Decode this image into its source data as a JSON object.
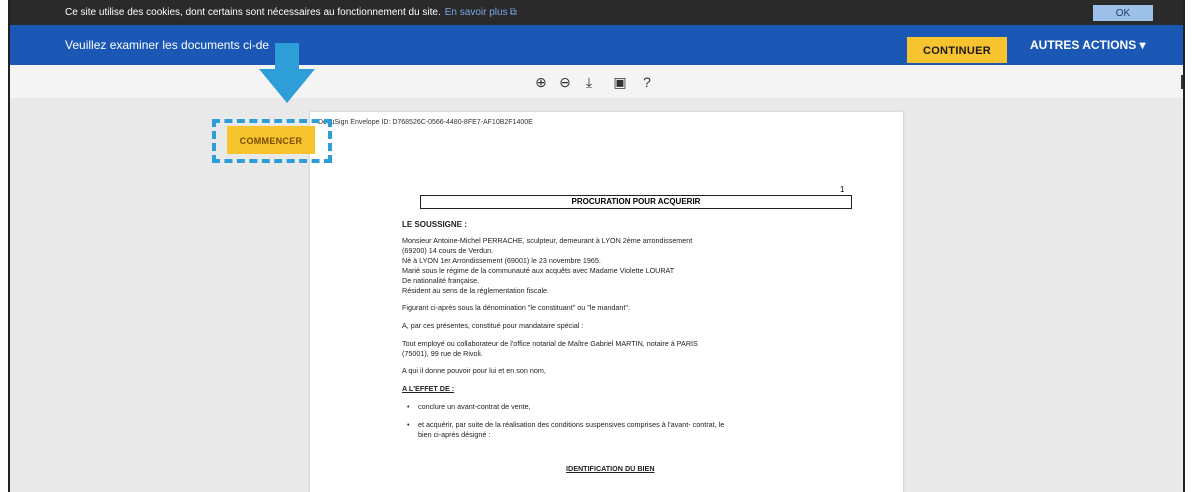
{
  "cookie": {
    "text": "Ce site utilise des cookies, dont certains sont nécessaires au fonctionnement du site.",
    "link": "En savoir plus",
    "ok": "OK"
  },
  "header": {
    "review_text": "Veuillez examiner les documents ci-de",
    "continue": "CONTINUER",
    "other_actions": "AUTRES ACTIONS ▾"
  },
  "toolbar": {
    "icons": [
      "zoom-in-icon",
      "zoom-out-icon",
      "download-icon",
      "print-icon",
      "help-icon"
    ]
  },
  "start_button": "COMMENCER",
  "document": {
    "envelope": "DocuSign Envelope ID: D768526C-0566-4480-8FE7-AF10B2F1400E",
    "page_number": "1",
    "title": "PROCURATION POUR ACQUERIR",
    "undersigned": "LE SOUSSIGNE :",
    "lines": [
      "Monsieur Antoine-Michel PERRACHE, sculpteur, demeurant à LYON 2ème arrondissement",
      "(69200) 14 cours de Verdun.",
      "Né à LYON 1er Arrondissement (69001) le 23 novembre 1965.",
      "Marié sous le régime de la communauté aux acquêts avec Madame Violette LOURAT",
      "De nationalité française.",
      "Résident au sens de la réglementation fiscale.",
      "Figurant ci-après sous la dénomination \"le constituant\" ou \"le mandant\".",
      "A, par ces présentes, constitué pour mandataire spécial :",
      "Tout employé ou collaborateur de l'office notarial de Maître Gabriel MARTIN, notaire à PARIS",
      "(75001), 99 rue de Rivoli.",
      "A qui il donne pouvoir pour lui et en son nom,"
    ],
    "effect_heading": "A L'EFFET DE :",
    "bullets": [
      "conclure un avant-contrat de vente,",
      "et acquérir, par suite de la réalisation des conditions suspensives comprises à l'avant- contrat, le",
      "bien ci-après désigné :"
    ],
    "section": "IDENTIFICATION DU BIEN"
  }
}
